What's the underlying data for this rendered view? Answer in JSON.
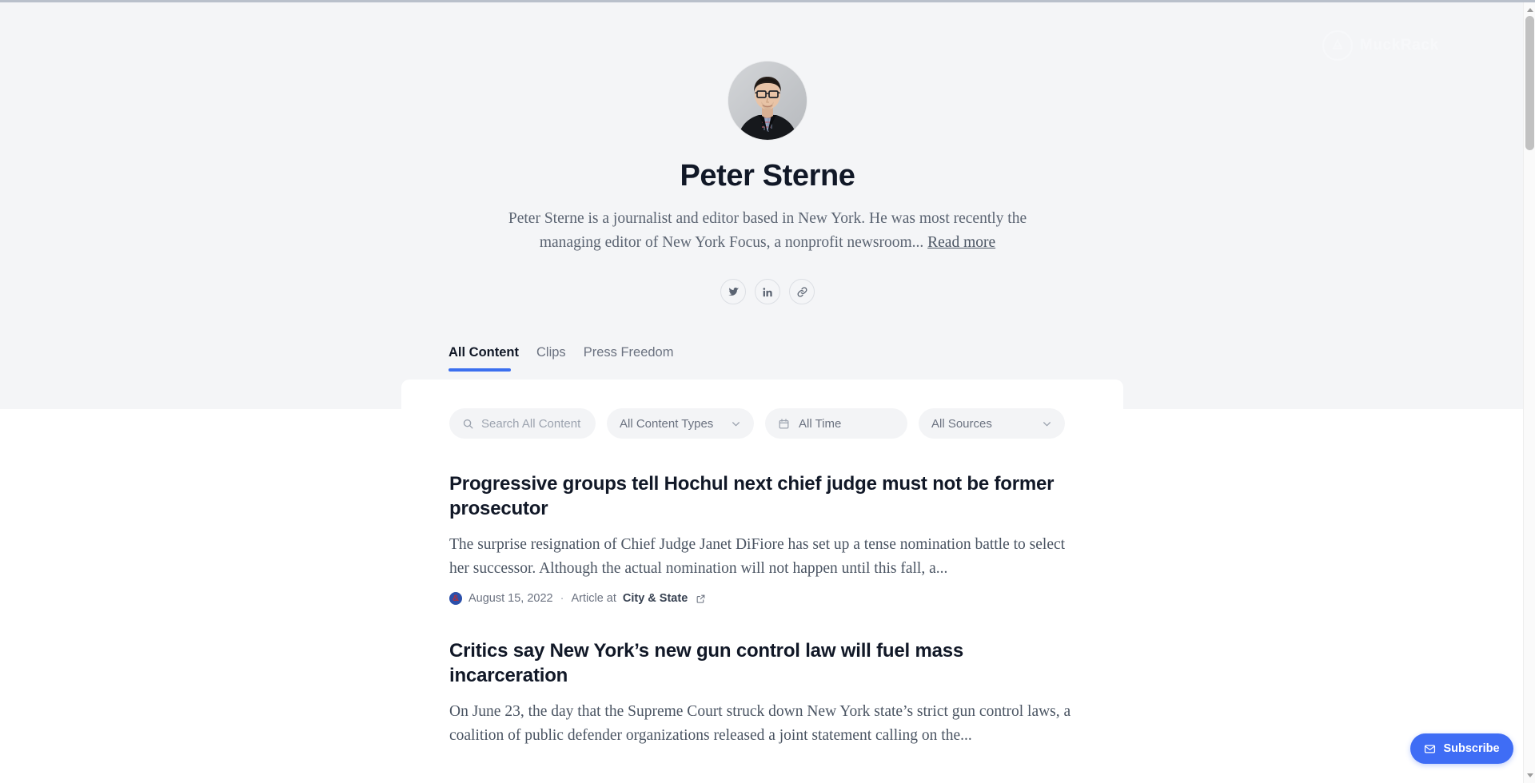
{
  "theme": {
    "page_bg": "#ffffff",
    "hero_bg": "#f4f5f7",
    "accent": "#3b6fef",
    "subscribe_bg": "#3f6df5",
    "heading_color": "#111827",
    "muted_color": "#6b7280",
    "favicon_bg": "#2b4faa",
    "favicon_glyph_color": "#b3303a"
  },
  "watermark": {
    "wordmark": "MuckRack",
    "badge_icon": "muckrack-logo-icon"
  },
  "profile": {
    "avatar_alt": "Peter Sterne",
    "name": "Peter Sterne",
    "bio": "Peter Sterne is a journalist and editor based in New York. He was most recently the managing editor of New York Focus, a nonprofit newsroom...",
    "read_more_label": "Read more",
    "socials": [
      {
        "name": "twitter",
        "icon": "twitter-icon"
      },
      {
        "name": "linkedin",
        "icon": "linkedin-icon"
      },
      {
        "name": "website",
        "icon": "link-icon"
      }
    ]
  },
  "tabs": [
    {
      "label": "All Content",
      "active": true
    },
    {
      "label": "Clips",
      "active": false
    },
    {
      "label": "Press Freedom",
      "active": false
    }
  ],
  "filters": {
    "search": {
      "icon": "search-icon",
      "placeholder": "Search All Content",
      "value": ""
    },
    "content_types": {
      "label": "All Content Types",
      "icon": "chevron-down-icon"
    },
    "time": {
      "label": "All Time",
      "icon": "calendar-icon"
    },
    "sources": {
      "label": "All Sources",
      "icon": "chevron-down-icon"
    }
  },
  "articles": [
    {
      "title": "Progressive groups tell Hochul next chief judge must not be former prosecutor",
      "description": "The surprise resignation of Chief Judge Janet DiFiore has set up a tense nomination battle to select her successor. Although the actual nomination will not happen until this fall, a...",
      "favicon_glyph": "&",
      "date": "August 15, 2022",
      "separator": "·",
      "source_prefix": "Article at",
      "source_name": "City & State",
      "external_icon": "external-link-icon"
    },
    {
      "title": "Critics say New York’s new gun control law will fuel mass incarceration",
      "description": "On June 23, the day that the Supreme Court struck down New York state’s strict gun control laws, a coalition of public defender organizations released a joint statement calling on the...",
      "favicon_glyph": "&",
      "date": "",
      "separator": "·",
      "source_prefix": "",
      "source_name": "",
      "external_icon": "external-link-icon"
    }
  ],
  "subscribe": {
    "label": "Subscribe",
    "icon": "envelope-icon"
  },
  "scrollbar": {
    "up_icon": "scroll-up-arrow-icon",
    "down_icon": "scroll-down-arrow-icon"
  }
}
